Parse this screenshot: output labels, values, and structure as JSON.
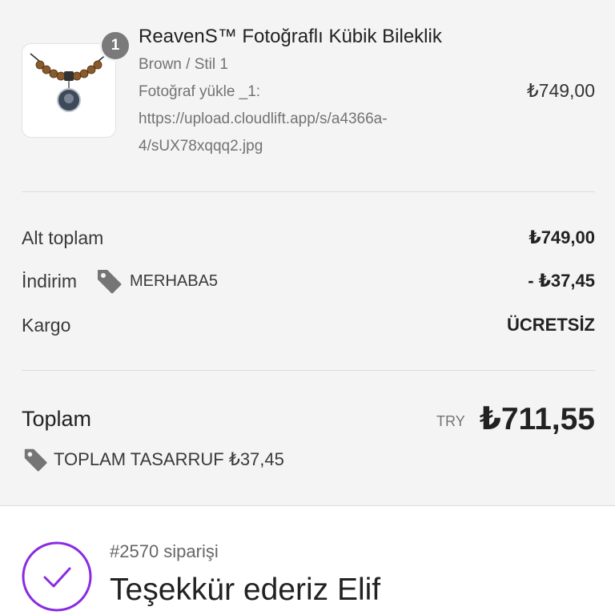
{
  "product": {
    "quantity": "1",
    "title": "ReavenS™ Fotoğraflı Kübik Bileklik",
    "variant": "Brown / Stil 1",
    "photo_label": "Fotoğraf yükle _1:",
    "photo_url_line1": "https://upload.cloudlift.app/s/a4366a-",
    "photo_url_line2": "4/sUX78xqqq2.jpg",
    "price": "₺749,00"
  },
  "summary": {
    "subtotal_label": "Alt toplam",
    "subtotal_value": "₺749,00",
    "discount_label": "İndirim",
    "discount_code": "MERHABA5",
    "discount_value": "- ₺37,45",
    "shipping_label": "Kargo",
    "shipping_value": "ÜCRETSİZ"
  },
  "total": {
    "label": "Toplam",
    "currency": "TRY",
    "value": "₺711,55",
    "savings": "TOPLAM TASARRUF ₺37,45"
  },
  "confirmation": {
    "order_number": "#2570 siparişi",
    "thanks": "Teşekkür ederiz Elif"
  },
  "colors": {
    "summary_bg": "#f4f4f4",
    "accent_purple": "#8a2be2",
    "badge_gray": "#7a7a7a"
  }
}
